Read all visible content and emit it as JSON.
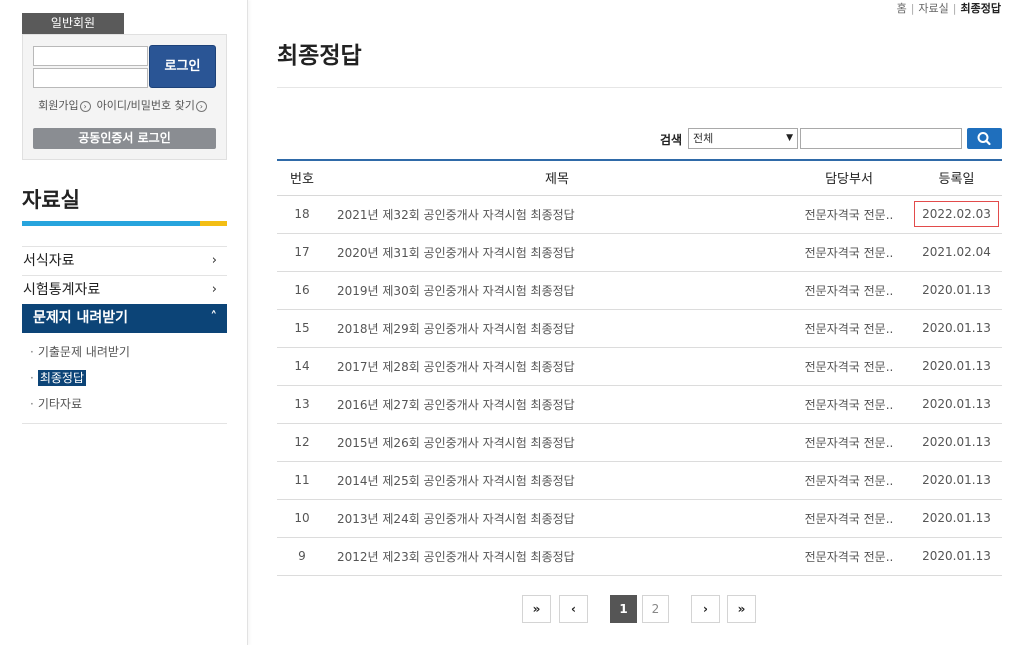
{
  "left": {
    "member_tab": "일반회원",
    "login_button": "로그인",
    "join_link": "회원가입",
    "find_link": "아이디/비밀번호 찾기",
    "cert_login": "공동인증서 로그인"
  },
  "section_title": "자료실",
  "menu": {
    "items": [
      {
        "label": "서식자료"
      },
      {
        "label": "시험통계자료"
      },
      {
        "label": "문제지 내려받기"
      }
    ],
    "sub": [
      {
        "label": "기출문제 내려받기"
      },
      {
        "label": "최종정답"
      },
      {
        "label": "기타자료"
      }
    ]
  },
  "breadcrumb": {
    "home": "홈",
    "parent": "자료실",
    "current": "최종정답"
  },
  "page_title": "최종정답",
  "search": {
    "label": "검색",
    "selected": "전체",
    "value": ""
  },
  "table": {
    "headers": [
      "번호",
      "제목",
      "담당부서",
      "등록일"
    ],
    "rows": [
      {
        "no": "18",
        "title": "2021년 제32회 공인중개사 자격시험 최종정답",
        "dept": "전문자격국 전문..",
        "date": "2022.02.03"
      },
      {
        "no": "17",
        "title": "2020년 제31회 공인중개사 자격시험 최종정답",
        "dept": "전문자격국 전문..",
        "date": "2021.02.04"
      },
      {
        "no": "16",
        "title": "2019년 제30회 공인중개사 자격시험 최종정답",
        "dept": "전문자격국 전문..",
        "date": "2020.01.13"
      },
      {
        "no": "15",
        "title": "2018년 제29회 공인중개사 자격시험 최종정답",
        "dept": "전문자격국 전문..",
        "date": "2020.01.13"
      },
      {
        "no": "14",
        "title": "2017년 제28회 공인중개사 자격시험 최종정답",
        "dept": "전문자격국 전문..",
        "date": "2020.01.13"
      },
      {
        "no": "13",
        "title": "2016년 제27회 공인중개사 자격시험 최종정답",
        "dept": "전문자격국 전문..",
        "date": "2020.01.13"
      },
      {
        "no": "12",
        "title": "2015년 제26회 공인중개사 자격시험 최종정답",
        "dept": "전문자격국 전문..",
        "date": "2020.01.13"
      },
      {
        "no": "11",
        "title": "2014년 제25회 공인중개사 자격시험 최종정답",
        "dept": "전문자격국 전문..",
        "date": "2020.01.13"
      },
      {
        "no": "10",
        "title": "2013년 제24회 공인중개사 자격시험 최종정답",
        "dept": "전문자격국 전문..",
        "date": "2020.01.13"
      },
      {
        "no": "9",
        "title": "2012년 제23회 공인중개사 자격시험 최종정답",
        "dept": "전문자격국 전문..",
        "date": "2020.01.13"
      }
    ]
  },
  "pagination": {
    "pages": [
      "1",
      "2"
    ],
    "current": "1"
  }
}
